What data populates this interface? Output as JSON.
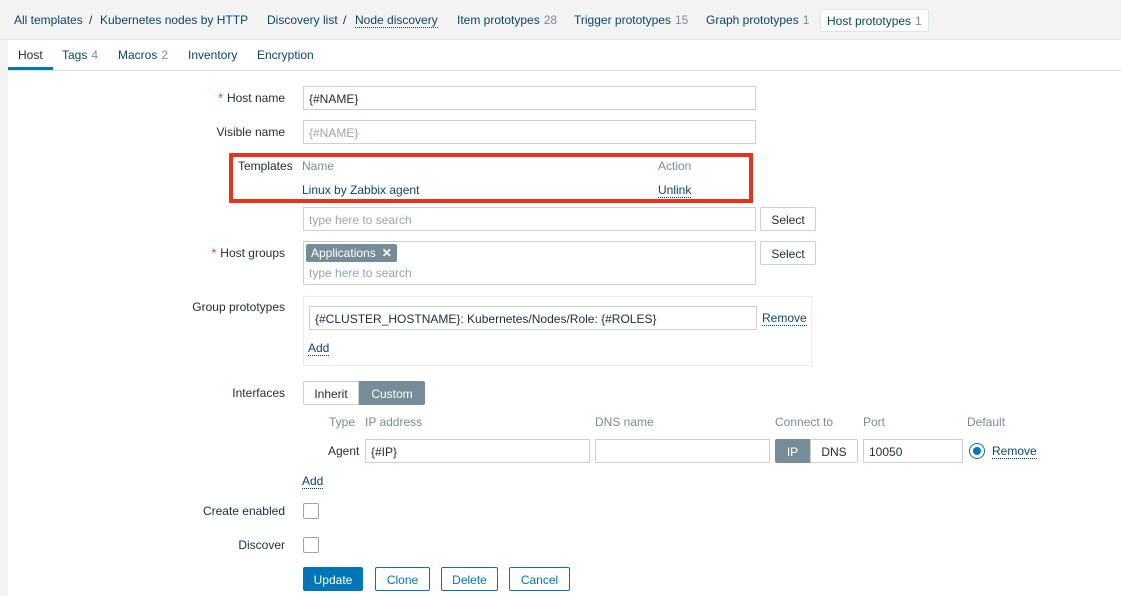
{
  "breadcrumb": {
    "all_templates": "All templates",
    "sep1": "/",
    "template": "Kubernetes nodes by HTTP",
    "discovery_list": "Discovery list",
    "sep2": "/",
    "node_discovery": "Node discovery",
    "item_prototypes": {
      "label": "Item prototypes",
      "count": "28"
    },
    "trigger_prototypes": {
      "label": "Trigger prototypes",
      "count": "15"
    },
    "graph_prototypes": {
      "label": "Graph prototypes",
      "count": "1"
    },
    "host_prototypes": {
      "label": "Host prototypes",
      "count": "1"
    }
  },
  "tabs": {
    "host": "Host",
    "tags": {
      "label": "Tags",
      "count": "4"
    },
    "macros": {
      "label": "Macros",
      "count": "2"
    },
    "inventory": "Inventory",
    "encryption": "Encryption"
  },
  "form": {
    "host_name": {
      "label": "Host name",
      "required": "*",
      "value": "{#NAME}"
    },
    "visible_name": {
      "label": "Visible name",
      "placeholder": "{#NAME}"
    },
    "templates": {
      "label": "Templates",
      "col_name": "Name",
      "col_action": "Action",
      "rows": [
        {
          "name": "Linux by Zabbix agent",
          "action": "Unlink"
        }
      ],
      "search_placeholder": "type here to search",
      "select_label": "Select"
    },
    "host_groups": {
      "label": "Host groups",
      "required": "*",
      "chips": [
        "Applications"
      ],
      "chip_remove": "✕",
      "search_placeholder": "type here to search",
      "select_label": "Select"
    },
    "group_prototypes": {
      "label": "Group prototypes",
      "value": "{#CLUSTER_HOSTNAME}: Kubernetes/Nodes/Role: {#ROLES}",
      "remove_label": "Remove",
      "add_label": "Add"
    },
    "interfaces": {
      "label": "Interfaces",
      "mode_inherit": "Inherit",
      "mode_custom": "Custom",
      "mode_selected": "Custom",
      "headers": {
        "type": "Type",
        "ip": "IP address",
        "dns": "DNS name",
        "connect": "Connect to",
        "port": "Port",
        "default": "Default"
      },
      "rows": [
        {
          "type": "Agent",
          "ip": "{#IP}",
          "dns": "",
          "connect_ip": "IP",
          "connect_dns": "DNS",
          "connect_selected": "IP",
          "port": "10050",
          "default": true,
          "remove": "Remove"
        }
      ],
      "add_label": "Add"
    },
    "create_enabled": {
      "label": "Create enabled",
      "checked": false
    },
    "discover": {
      "label": "Discover",
      "checked": false
    },
    "buttons": {
      "update": "Update",
      "clone": "Clone",
      "delete": "Delete",
      "cancel": "Cancel"
    }
  },
  "colors": {
    "link": "#0a466a",
    "primary": "#0275b8",
    "chip": "#768d99",
    "required": "#e33734",
    "highlight": "#e8321b"
  }
}
